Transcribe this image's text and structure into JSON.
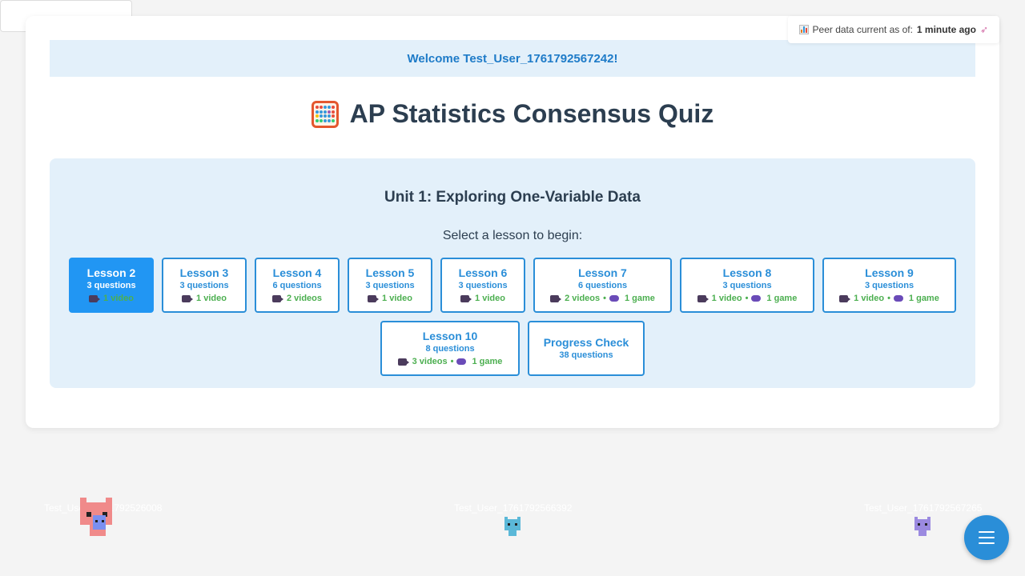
{
  "peer_status": {
    "prefix": "Peer data current as of:",
    "value": "1 minute ago",
    "icon_left": "bar-chart-icon",
    "icon_right": "rocket-icon"
  },
  "welcome": "Welcome Test_User_1761792567242!",
  "title": {
    "icon": "abacus-icon",
    "text": "AP Statistics Consensus Quiz"
  },
  "unit": {
    "title": "Unit 1: Exploring One-Variable Data",
    "subtitle": "Select a lesson to begin:"
  },
  "lessons": [
    {
      "name": "Lesson 2",
      "questions": "3 questions",
      "videos": "1 video",
      "games": "",
      "active": true
    },
    {
      "name": "Lesson 3",
      "questions": "3 questions",
      "videos": "1 video",
      "games": ""
    },
    {
      "name": "Lesson 4",
      "questions": "6 questions",
      "videos": "2 videos",
      "games": ""
    },
    {
      "name": "Lesson 5",
      "questions": "3 questions",
      "videos": "1 video",
      "games": ""
    },
    {
      "name": "Lesson 6",
      "questions": "3 questions",
      "videos": "1 video",
      "games": ""
    },
    {
      "name": "Lesson 7",
      "questions": "6 questions",
      "videos": "2 videos",
      "games": "1 game"
    },
    {
      "name": "Lesson 8",
      "questions": "3 questions",
      "videos": "1 video",
      "games": "1 game"
    },
    {
      "name": "Lesson 9",
      "questions": "3 questions",
      "videos": "1 video",
      "games": "1 game"
    },
    {
      "name": "Lesson 10",
      "questions": "8 questions",
      "videos": "3 videos",
      "games": "1 game"
    },
    {
      "name": "Progress Check",
      "questions": "38 questions",
      "videos": "",
      "games": ""
    }
  ],
  "separator": "•",
  "avatars": [
    {
      "label": "Test_User_1761792526008",
      "color": "#f08a8a"
    },
    {
      "label": "Test_User_1761792566392",
      "color": "#5bb8d8"
    },
    {
      "label": "Test_User_1761792567265",
      "color": "#9b8ae0"
    }
  ],
  "menu_button": "hamburger-menu-icon"
}
